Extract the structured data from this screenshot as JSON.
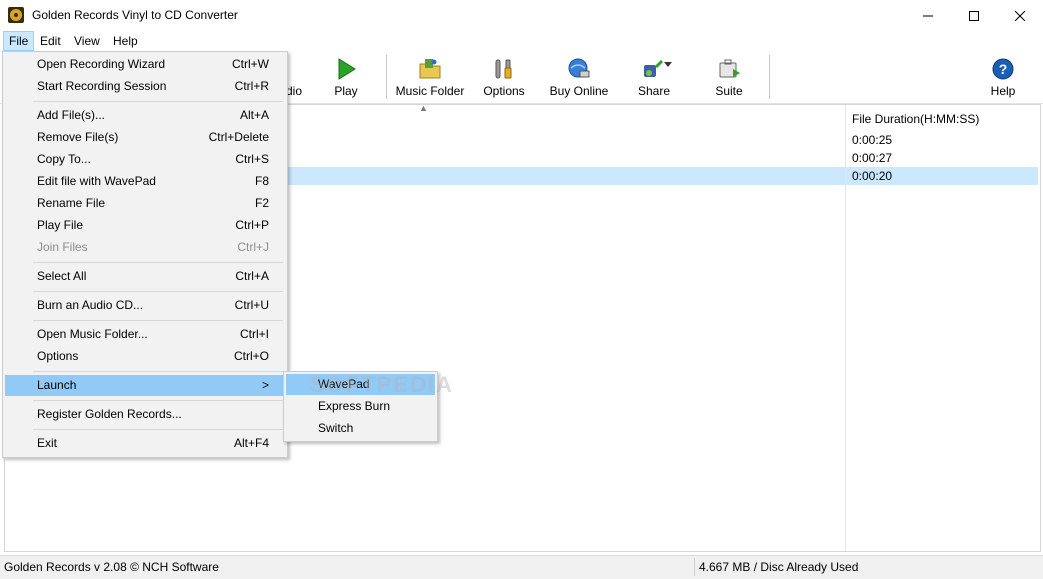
{
  "window": {
    "title": "Golden Records Vinyl to CD Converter"
  },
  "menubar": {
    "items": [
      {
        "label": "File"
      },
      {
        "label": "Edit"
      },
      {
        "label": "View"
      },
      {
        "label": "Help"
      }
    ]
  },
  "toolbar": {
    "partial_label": "dio",
    "buttons": [
      {
        "label": "Play",
        "icon": "play-icon"
      },
      {
        "label": "Music Folder",
        "icon": "folder-icon"
      },
      {
        "label": "Options",
        "icon": "options-icon"
      },
      {
        "label": "Buy Online",
        "icon": "globe-cart-icon"
      },
      {
        "label": "Share",
        "icon": "share-icon"
      },
      {
        "label": "Suite",
        "icon": "suite-icon"
      },
      {
        "label": "Help",
        "icon": "help-icon"
      }
    ]
  },
  "file_list": {
    "duration_header": "File Duration(H:MM:SS)",
    "durations": [
      "0:00:25",
      "0:00:27",
      "0:00:20"
    ],
    "selected_index": 2
  },
  "file_menu": {
    "items": [
      {
        "label": "Open Recording Wizard",
        "shortcut": "Ctrl+W"
      },
      {
        "label": "Start Recording Session",
        "shortcut": "Ctrl+R"
      },
      {
        "label": "Add File(s)...",
        "shortcut": "Alt+A"
      },
      {
        "label": "Remove File(s)",
        "shortcut": "Ctrl+Delete"
      },
      {
        "label": "Copy To...",
        "shortcut": "Ctrl+S"
      },
      {
        "label": "Edit file with WavePad",
        "shortcut": "F8"
      },
      {
        "label": "Rename File",
        "shortcut": "F2"
      },
      {
        "label": "Play File",
        "shortcut": "Ctrl+P"
      },
      {
        "label": "Join Files",
        "shortcut": "Ctrl+J",
        "disabled": true
      },
      {
        "label": "Select All",
        "shortcut": "Ctrl+A"
      },
      {
        "label": "Burn an Audio CD...",
        "shortcut": "Ctrl+U"
      },
      {
        "label": "Open Music Folder...",
        "shortcut": "Ctrl+I"
      },
      {
        "label": "Options",
        "shortcut": "Ctrl+O"
      },
      {
        "label": "Launch",
        "shortcut": ">",
        "highlighted": true
      },
      {
        "label": "Register Golden Records...",
        "shortcut": ""
      },
      {
        "label": "Exit",
        "shortcut": "Alt+F4"
      }
    ]
  },
  "launch_submenu": {
    "items": [
      {
        "label": "WavePad"
      },
      {
        "label": "Express Burn"
      },
      {
        "label": "Switch"
      }
    ]
  },
  "watermark": "SOFTPEDIA",
  "statusbar": {
    "left": "Golden Records v 2.08 © NCH Software",
    "right": "4.667 MB / Disc Already Used"
  },
  "colors": {
    "menu_highlight": "#91c9f7",
    "selected_row": "#cce8ff",
    "menu_bg": "#f2f2f2"
  }
}
